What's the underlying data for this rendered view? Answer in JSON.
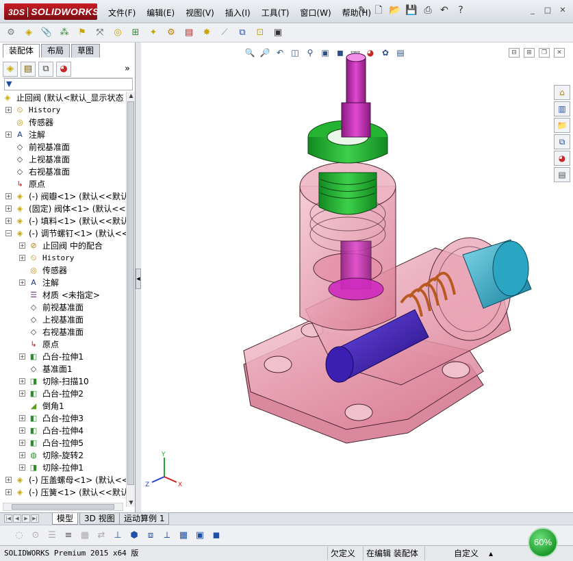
{
  "app": {
    "logo_ds": "3DS",
    "logo_text": "SOLIDWORKS"
  },
  "menu": [
    "文件(F)",
    "编辑(E)",
    "视图(V)",
    "插入(I)",
    "工具(T)",
    "窗口(W)",
    "帮助(H)"
  ],
  "window_controls": [
    "_",
    "□",
    "✕"
  ],
  "left_panel": {
    "tabs": [
      "装配体",
      "布局",
      "草图"
    ],
    "active_tab": 0,
    "filter_glyph": "▼",
    "more_glyph": "»",
    "tree": [
      {
        "level": 0,
        "expander": "",
        "icon": "assembly-icon",
        "glyph": "◈",
        "color": "#c8a400",
        "label": "止回阀 (默认<默认_显示状态"
      },
      {
        "level": 1,
        "expander": "+",
        "icon": "history-icon",
        "glyph": "⏲",
        "color": "#b07a00",
        "label": "History",
        "mono": true
      },
      {
        "level": 1,
        "expander": "",
        "icon": "sensor-icon",
        "glyph": "◎",
        "color": "#c79000",
        "label": "传感器"
      },
      {
        "level": 1,
        "expander": "+",
        "icon": "annotation-icon",
        "glyph": "A",
        "color": "#1f3a8a",
        "label": "注解"
      },
      {
        "level": 1,
        "expander": "",
        "icon": "plane-icon",
        "glyph": "◇",
        "color": "#333",
        "label": "前视基准面"
      },
      {
        "level": 1,
        "expander": "",
        "icon": "plane-icon",
        "glyph": "◇",
        "color": "#333",
        "label": "上视基准面"
      },
      {
        "level": 1,
        "expander": "",
        "icon": "plane-icon",
        "glyph": "◇",
        "color": "#333",
        "label": "右视基准面"
      },
      {
        "level": 1,
        "expander": "",
        "icon": "origin-icon",
        "glyph": "↳",
        "color": "#b41d1d",
        "label": "原点"
      },
      {
        "level": 1,
        "expander": "+",
        "icon": "part-icon",
        "glyph": "◈",
        "color": "#c8a400",
        "label": "(-) 阀瓣<1> (默认<<默认"
      },
      {
        "level": 1,
        "expander": "+",
        "icon": "part-icon",
        "glyph": "◈",
        "color": "#c8a400",
        "label": "(固定) 阀体<1> (默认<<"
      },
      {
        "level": 1,
        "expander": "+",
        "icon": "part-icon",
        "glyph": "◈",
        "color": "#c8a400",
        "label": "(-) 填料<1> (默认<<默认"
      },
      {
        "level": 1,
        "expander": "−",
        "icon": "part-icon",
        "glyph": "◈",
        "color": "#c8a400",
        "label": "(-) 调节螺钉<1> (默认<<"
      },
      {
        "level": 2,
        "expander": "+",
        "icon": "mates-icon",
        "glyph": "⊘",
        "color": "#b07a00",
        "label": "止回阀 中的配合"
      },
      {
        "level": 2,
        "expander": "+",
        "icon": "history-icon",
        "glyph": "⏲",
        "color": "#b07a00",
        "label": "History",
        "mono": true
      },
      {
        "level": 2,
        "expander": "",
        "icon": "sensor-icon",
        "glyph": "◎",
        "color": "#c79000",
        "label": "传感器"
      },
      {
        "level": 2,
        "expander": "+",
        "icon": "annotation-icon",
        "glyph": "A",
        "color": "#1f3a8a",
        "label": "注解"
      },
      {
        "level": 2,
        "expander": "",
        "icon": "material-icon",
        "glyph": "☰",
        "color": "#6b2b8a",
        "label": "材质 <未指定>"
      },
      {
        "level": 2,
        "expander": "",
        "icon": "plane-icon",
        "glyph": "◇",
        "color": "#333",
        "label": "前视基准面"
      },
      {
        "level": 2,
        "expander": "",
        "icon": "plane-icon",
        "glyph": "◇",
        "color": "#333",
        "label": "上视基准面"
      },
      {
        "level": 2,
        "expander": "",
        "icon": "plane-icon",
        "glyph": "◇",
        "color": "#333",
        "label": "右视基准面"
      },
      {
        "level": 2,
        "expander": "",
        "icon": "origin-icon",
        "glyph": "↳",
        "color": "#b41d1d",
        "label": "原点"
      },
      {
        "level": 2,
        "expander": "+",
        "icon": "boss-extrude-icon",
        "glyph": "◧",
        "color": "#2d8a2d",
        "label": "凸台-拉伸1"
      },
      {
        "level": 2,
        "expander": "",
        "icon": "plane-icon",
        "glyph": "◇",
        "color": "#333",
        "label": "基准面1"
      },
      {
        "level": 2,
        "expander": "+",
        "icon": "cut-sweep-icon",
        "glyph": "◨",
        "color": "#2d8a2d",
        "label": "切除-扫描10"
      },
      {
        "level": 2,
        "expander": "+",
        "icon": "boss-extrude-icon",
        "glyph": "◧",
        "color": "#2d8a2d",
        "label": "凸台-拉伸2"
      },
      {
        "level": 2,
        "expander": "",
        "icon": "chamfer-icon",
        "glyph": "◢",
        "color": "#5b9b1f",
        "label": "倒角1"
      },
      {
        "level": 2,
        "expander": "+",
        "icon": "boss-extrude-icon",
        "glyph": "◧",
        "color": "#2d8a2d",
        "label": "凸台-拉伸3"
      },
      {
        "level": 2,
        "expander": "+",
        "icon": "boss-extrude-icon",
        "glyph": "◧",
        "color": "#2d8a2d",
        "label": "凸台-拉伸4"
      },
      {
        "level": 2,
        "expander": "+",
        "icon": "boss-extrude-icon",
        "glyph": "◧",
        "color": "#2d8a2d",
        "label": "凸台-拉伸5"
      },
      {
        "level": 2,
        "expander": "+",
        "icon": "cut-revolve-icon",
        "glyph": "◍",
        "color": "#2d8a2d",
        "label": "切除-旋转2"
      },
      {
        "level": 2,
        "expander": "+",
        "icon": "cut-extrude-icon",
        "glyph": "◨",
        "color": "#2d8a2d",
        "label": "切除-拉伸1"
      },
      {
        "level": 1,
        "expander": "+",
        "icon": "part-icon",
        "glyph": "◈",
        "color": "#c8a400",
        "label": "(-) 压盖螺母<1> (默认<<"
      },
      {
        "level": 1,
        "expander": "+",
        "icon": "part-icon",
        "glyph": "◈",
        "color": "#c8a400",
        "label": "(-) 压簧<1> (默认<<默认"
      }
    ]
  },
  "bottom_tabs": [
    "模型",
    "3D 视图",
    "运动算例 1"
  ],
  "active_bottom_tab": 0,
  "status": {
    "product": "SOLIDWORKS Premium 2015 x64 版",
    "under_defined": "欠定义",
    "editing": "在编辑 装配体",
    "custom": "自定义",
    "caret": "▴"
  },
  "performance_badge": "60%",
  "triad": {
    "x": "X",
    "y": "Y",
    "z": "Z"
  },
  "colors": {
    "valve_body": "#e8a3b4",
    "valve_edge": "#4a2530",
    "cap_green": "#22b030",
    "stem_magenta": "#c61cb8",
    "nut_cyan": "#2aa6c2",
    "spring_orange": "#e0905a",
    "piston_blue": "#3b1fb0"
  }
}
